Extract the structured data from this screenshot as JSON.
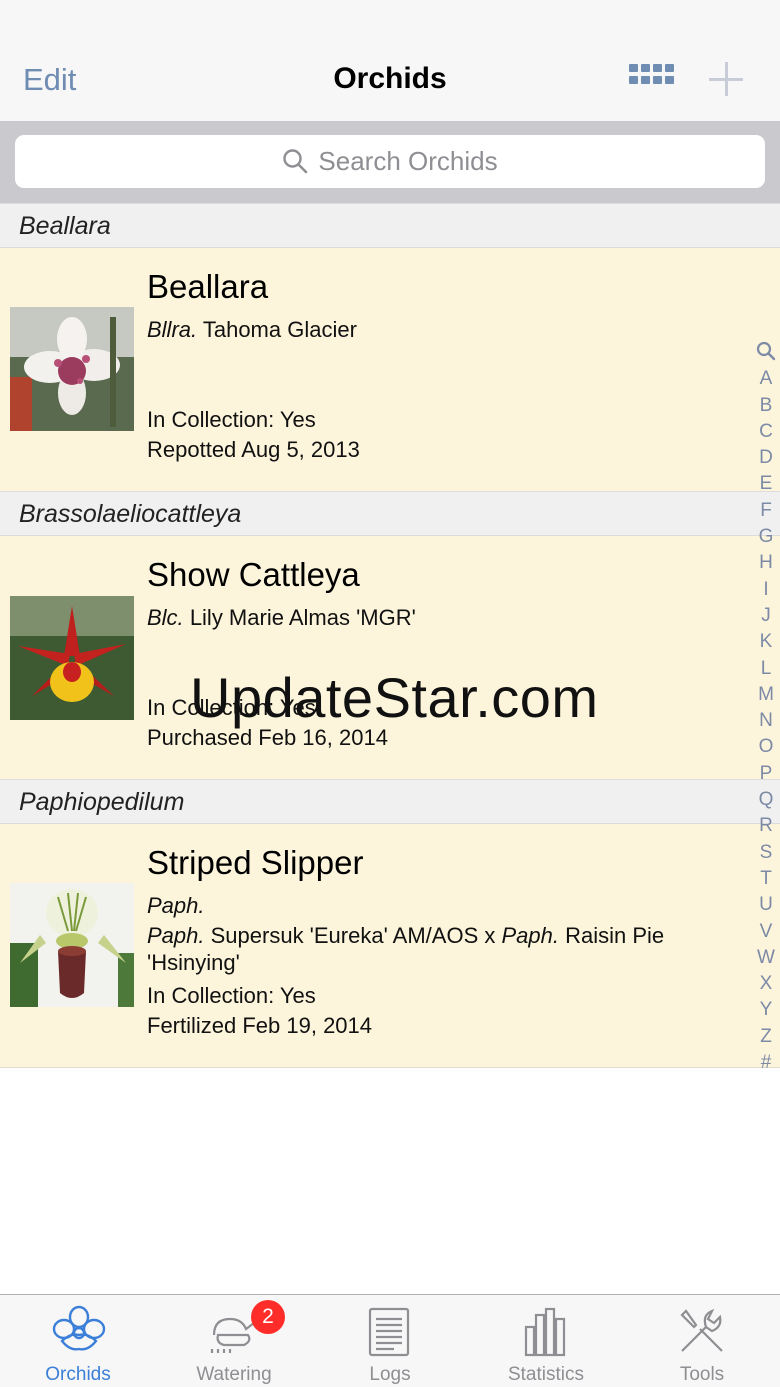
{
  "nav": {
    "edit_label": "Edit",
    "title": "Orchids"
  },
  "search": {
    "placeholder": "Search Orchids"
  },
  "sections": [
    {
      "header": "Beallara",
      "item": {
        "title": "Beallara",
        "abbr": "Bllra.",
        "name": "Tahoma Glacier",
        "collection": "In Collection: Yes",
        "event": "Repotted Aug 5, 2013"
      }
    },
    {
      "header": "Brassolaeliocattleya",
      "item": {
        "title": "Show Cattleya",
        "abbr": "Blc.",
        "name": "Lily Marie Almas 'MGR'",
        "collection": "In Collection: Yes",
        "event": "Purchased Feb 16, 2014"
      }
    },
    {
      "header": "Paphiopedilum",
      "item": {
        "title": "Striped Slipper",
        "abbr": "Paph.",
        "parent1_abbr": "Paph.",
        "parent1": "Supersuk 'Eureka' AM/AOS x",
        "parent2_abbr": "Paph.",
        "parent2": "Raisin Pie",
        "parent2_cont": "'Hsinying'",
        "collection": "In Collection: Yes",
        "event": "Fertilized Feb 19, 2014"
      }
    }
  ],
  "index": [
    "A",
    "B",
    "C",
    "D",
    "E",
    "F",
    "G",
    "H",
    "I",
    "J",
    "K",
    "L",
    "M",
    "N",
    "O",
    "P",
    "Q",
    "R",
    "S",
    "T",
    "U",
    "V",
    "W",
    "X",
    "Y",
    "Z",
    "#"
  ],
  "watermark": "UpdateStar.com",
  "tabs": [
    {
      "label": "Orchids",
      "icon": "orchid-icon",
      "active": true
    },
    {
      "label": "Watering",
      "icon": "watering-icon",
      "badge": "2"
    },
    {
      "label": "Logs",
      "icon": "logs-icon"
    },
    {
      "label": "Statistics",
      "icon": "statistics-icon"
    },
    {
      "label": "Tools",
      "icon": "tools-icon"
    }
  ],
  "colors": {
    "accent": "#6f8cb3",
    "tab_active": "#3b7fd8",
    "row_bg": "#fcf5dc",
    "badge": "#ff2d2a"
  }
}
